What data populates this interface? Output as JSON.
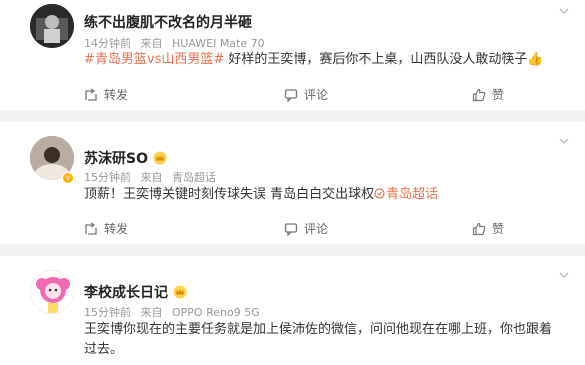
{
  "comments": [
    {
      "name": "练不出腹肌不改名的月半砸",
      "time": "14分钟前",
      "source_prefix": "来自",
      "source": "HUAWEI Mate 70",
      "hashtag": "#青岛男篮vs山西男篮#",
      "text": " 好样的王奕博，赛后你不上桌，山西队没人敢动筷子",
      "emoji": "👍",
      "forward_label": "转发",
      "comment_label": "评论",
      "like_label": "赞"
    },
    {
      "name": "苏沫研SO",
      "time": "15分钟前",
      "source_prefix": "来自",
      "source": "青岛超话",
      "text": "顶薪！王奕博关键时刻传球失误 青岛白白交出球权",
      "topic": "青岛超话",
      "forward_label": "转发",
      "comment_label": "评论",
      "like_label": "赞"
    },
    {
      "name": "李校成长日记",
      "time": "15分钟前",
      "source_prefix": "来自",
      "source": "OPPO Reno9 5G",
      "text": "王奕博你现在的主要任务就是加上侯沛佐的微信，问问他现在在哪上班，你也跟着过去。"
    }
  ],
  "colors": {
    "accent_orange": "#eb7350",
    "background": "#f2f2f2",
    "meta_gray": "#999999"
  }
}
